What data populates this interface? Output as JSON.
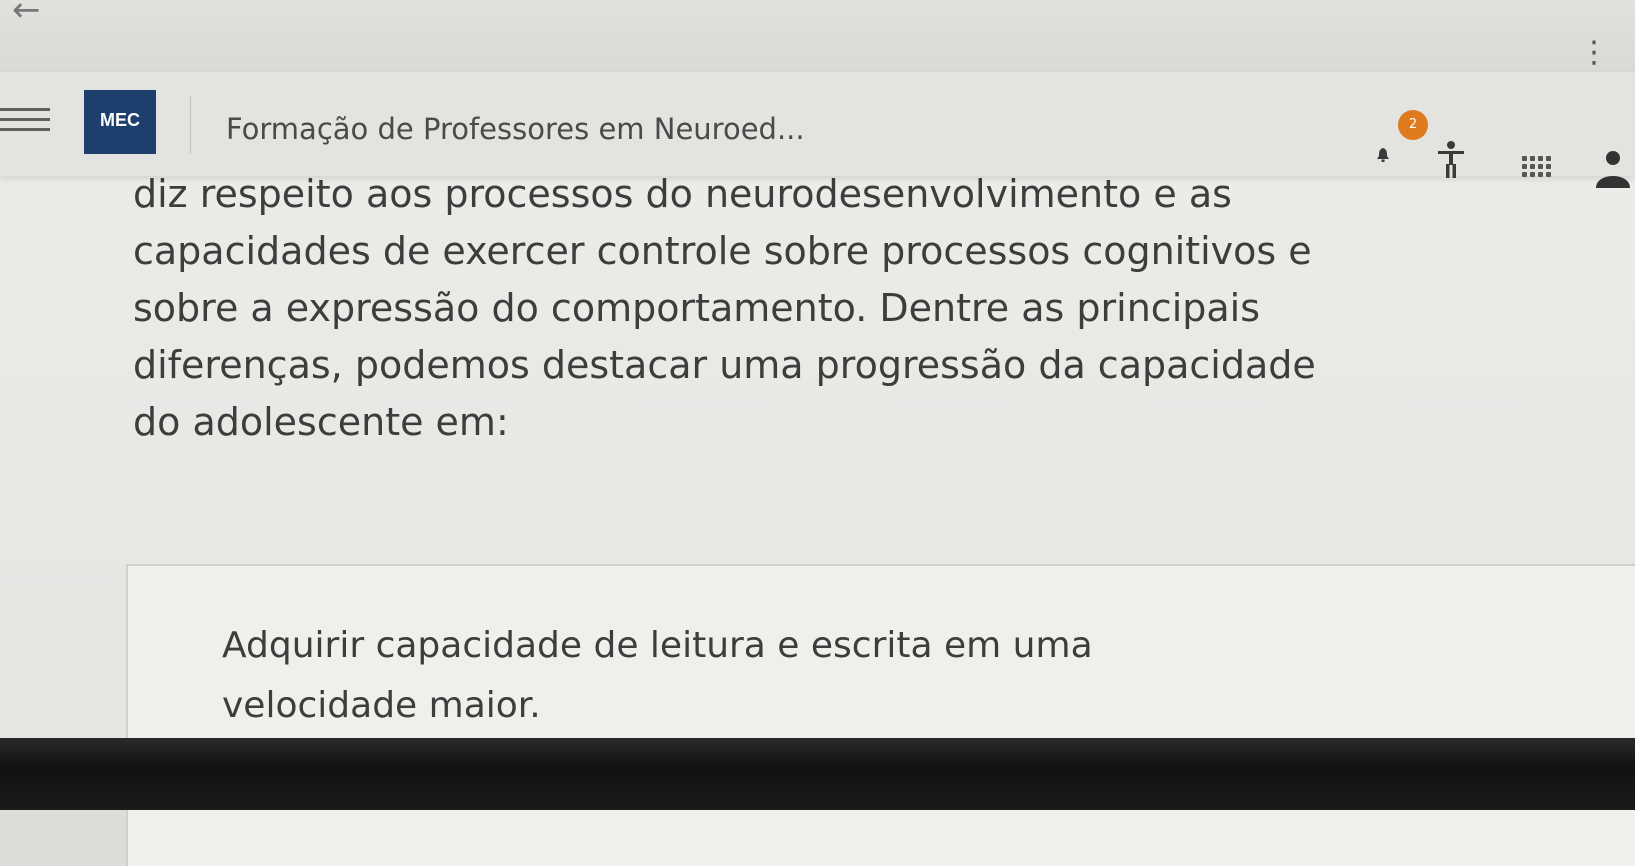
{
  "browser": {
    "back_icon": "arrow-left-icon",
    "more_icon": "vertical-dots-icon"
  },
  "header": {
    "menu_icon": "hamburger-menu-icon",
    "logo_text": "MEC",
    "course_title": "Formação de Professores em Neuroed...",
    "notification_count": "2",
    "icons": [
      "bell-icon",
      "accessibility-icon",
      "apps-grid-icon",
      "user-icon"
    ]
  },
  "question": {
    "lines": [
      "diz respeito aos processos do neurodesenvolvimento e as",
      "capacidades de exercer controle sobre processos cognitivos e",
      "sobre a expressão do comportamento. Dentre as principais",
      "diferenças, podemos destacar uma progressão da capacidade",
      "do adolescente em:"
    ]
  },
  "options": [
    {
      "lines": [
        "Adquirir capacidade de leitura e escrita em uma",
        "velocidade maior."
      ]
    }
  ],
  "colors": {
    "logo_bg": "#1d3f6e",
    "badge_bg": "#e07a1e",
    "page_bg": "#ebebe8"
  }
}
